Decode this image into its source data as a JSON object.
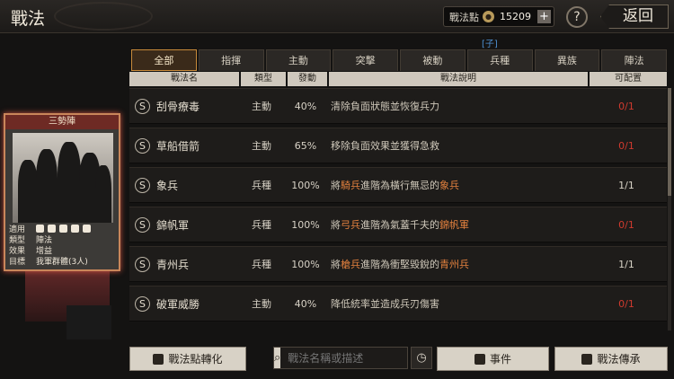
{
  "header": {
    "title": "戰法",
    "points_label": "戰法點",
    "points_value": "15209",
    "points_plus": "+",
    "help": "?",
    "back": "返回",
    "subtag": "[子]"
  },
  "tabs": [
    "全部",
    "指揮",
    "主動",
    "突擊",
    "被動",
    "兵種",
    "異族",
    "陣法"
  ],
  "columns": {
    "name": "戰法名",
    "type": "類型",
    "trigger": "發動",
    "desc": "戰法說明",
    "config": "可配置"
  },
  "rows": [
    {
      "badge": "S",
      "name": "刮骨療毒",
      "type": "主動",
      "trigger": "40%",
      "desc_pre": "清除負面狀態並恢復兵力",
      "desc_hl1": "",
      "desc_mid": "",
      "desc_hl2": "",
      "config": "0/1"
    },
    {
      "badge": "S",
      "name": "草船借箭",
      "type": "主動",
      "trigger": "65%",
      "desc_pre": "移除負面效果並獲得急救",
      "desc_hl1": "",
      "desc_mid": "",
      "desc_hl2": "",
      "config": "0/1"
    },
    {
      "badge": "S",
      "name": "象兵",
      "type": "兵種",
      "trigger": "100%",
      "desc_pre": "將",
      "desc_hl1": "騎兵",
      "desc_mid": "進階為橫行無忌的",
      "desc_hl2": "象兵",
      "config": "1/1"
    },
    {
      "badge": "S",
      "name": "錦帆軍",
      "type": "兵種",
      "trigger": "100%",
      "desc_pre": "將",
      "desc_hl1": "弓兵",
      "desc_mid": "進階為氣蓋千夫的",
      "desc_hl2": "錦帆軍",
      "config": "0/1"
    },
    {
      "badge": "S",
      "name": "青州兵",
      "type": "兵種",
      "trigger": "100%",
      "desc_pre": "將",
      "desc_hl1": "槍兵",
      "desc_mid": "進階為衝堅毀銳的",
      "desc_hl2": "青州兵",
      "config": "1/1"
    },
    {
      "badge": "S",
      "name": "破軍威勝",
      "type": "主動",
      "trigger": "40%",
      "desc_pre": "降低統率並造成兵刃傷害",
      "desc_hl1": "",
      "desc_mid": "",
      "desc_hl2": "",
      "config": "0/1"
    }
  ],
  "card": {
    "title": "三勢陣",
    "info": [
      {
        "k": "適用",
        "v": ""
      },
      {
        "k": "類型",
        "v": "陣法"
      },
      {
        "k": "效果",
        "v": "增益"
      },
      {
        "k": "目標",
        "v": "我軍群體(3人)"
      }
    ]
  },
  "bottom": {
    "convert": "戰法點轉化",
    "search_placeholder": "戰法名稱或描述",
    "events": "事件",
    "inherit": "戰法傳承"
  },
  "colors": {
    "accent": "#c88a3a",
    "highlight": "#e2803e",
    "unavailable": "#d03a2e"
  }
}
